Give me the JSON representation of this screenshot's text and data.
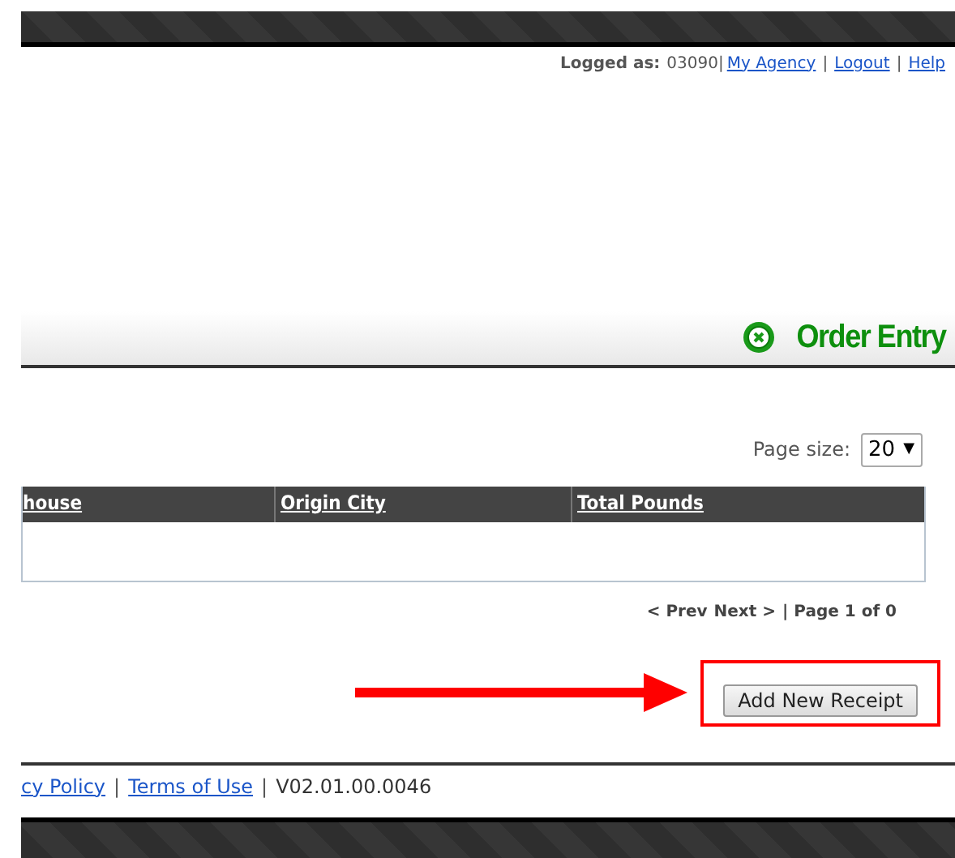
{
  "account_bar": {
    "label": "Logged as:",
    "items": [
      {
        "kind": "text",
        "text": "03090|"
      },
      {
        "kind": "link",
        "text": "My Agency"
      },
      {
        "kind": "sep",
        "text": "|"
      },
      {
        "kind": "link",
        "text": "Logout"
      },
      {
        "kind": "sep",
        "text": "|"
      },
      {
        "kind": "link",
        "text": "Help"
      }
    ]
  },
  "page_title": "Order Entry",
  "page_size": {
    "label": "Page size:",
    "value": "20",
    "caret": "▼"
  },
  "table": {
    "columns": [
      "house",
      "Origin City",
      "Total Pounds"
    ]
  },
  "pager": [
    "< Prev",
    "Next >",
    "| Page 1 of 0"
  ],
  "add_button": "Add New Receipt",
  "footer": [
    {
      "kind": "link",
      "text": "cy Policy"
    },
    {
      "kind": "sep",
      "text": "|"
    },
    {
      "kind": "link",
      "text": "Terms of Use"
    },
    {
      "kind": "sep",
      "text": "|"
    },
    {
      "kind": "text",
      "text": "V02.01.00.0046"
    }
  ]
}
